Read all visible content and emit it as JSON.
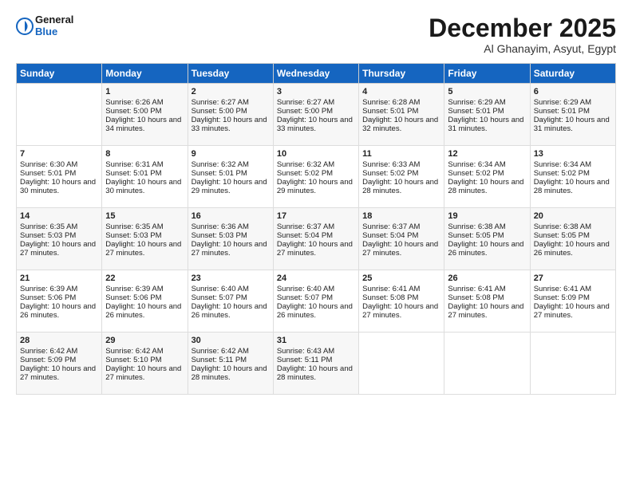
{
  "header": {
    "logo_line1": "General",
    "logo_line2": "Blue",
    "month": "December 2025",
    "location": "Al Ghanayim, Asyut, Egypt"
  },
  "days_of_week": [
    "Sunday",
    "Monday",
    "Tuesday",
    "Wednesday",
    "Thursday",
    "Friday",
    "Saturday"
  ],
  "weeks": [
    [
      {
        "day": "",
        "sunrise": "",
        "sunset": "",
        "daylight": ""
      },
      {
        "day": "1",
        "sunrise": "Sunrise: 6:26 AM",
        "sunset": "Sunset: 5:00 PM",
        "daylight": "Daylight: 10 hours and 34 minutes."
      },
      {
        "day": "2",
        "sunrise": "Sunrise: 6:27 AM",
        "sunset": "Sunset: 5:00 PM",
        "daylight": "Daylight: 10 hours and 33 minutes."
      },
      {
        "day": "3",
        "sunrise": "Sunrise: 6:27 AM",
        "sunset": "Sunset: 5:00 PM",
        "daylight": "Daylight: 10 hours and 33 minutes."
      },
      {
        "day": "4",
        "sunrise": "Sunrise: 6:28 AM",
        "sunset": "Sunset: 5:01 PM",
        "daylight": "Daylight: 10 hours and 32 minutes."
      },
      {
        "day": "5",
        "sunrise": "Sunrise: 6:29 AM",
        "sunset": "Sunset: 5:01 PM",
        "daylight": "Daylight: 10 hours and 31 minutes."
      },
      {
        "day": "6",
        "sunrise": "Sunrise: 6:29 AM",
        "sunset": "Sunset: 5:01 PM",
        "daylight": "Daylight: 10 hours and 31 minutes."
      }
    ],
    [
      {
        "day": "7",
        "sunrise": "Sunrise: 6:30 AM",
        "sunset": "Sunset: 5:01 PM",
        "daylight": "Daylight: 10 hours and 30 minutes."
      },
      {
        "day": "8",
        "sunrise": "Sunrise: 6:31 AM",
        "sunset": "Sunset: 5:01 PM",
        "daylight": "Daylight: 10 hours and 30 minutes."
      },
      {
        "day": "9",
        "sunrise": "Sunrise: 6:32 AM",
        "sunset": "Sunset: 5:01 PM",
        "daylight": "Daylight: 10 hours and 29 minutes."
      },
      {
        "day": "10",
        "sunrise": "Sunrise: 6:32 AM",
        "sunset": "Sunset: 5:02 PM",
        "daylight": "Daylight: 10 hours and 29 minutes."
      },
      {
        "day": "11",
        "sunrise": "Sunrise: 6:33 AM",
        "sunset": "Sunset: 5:02 PM",
        "daylight": "Daylight: 10 hours and 28 minutes."
      },
      {
        "day": "12",
        "sunrise": "Sunrise: 6:34 AM",
        "sunset": "Sunset: 5:02 PM",
        "daylight": "Daylight: 10 hours and 28 minutes."
      },
      {
        "day": "13",
        "sunrise": "Sunrise: 6:34 AM",
        "sunset": "Sunset: 5:02 PM",
        "daylight": "Daylight: 10 hours and 28 minutes."
      }
    ],
    [
      {
        "day": "14",
        "sunrise": "Sunrise: 6:35 AM",
        "sunset": "Sunset: 5:03 PM",
        "daylight": "Daylight: 10 hours and 27 minutes."
      },
      {
        "day": "15",
        "sunrise": "Sunrise: 6:35 AM",
        "sunset": "Sunset: 5:03 PM",
        "daylight": "Daylight: 10 hours and 27 minutes."
      },
      {
        "day": "16",
        "sunrise": "Sunrise: 6:36 AM",
        "sunset": "Sunset: 5:03 PM",
        "daylight": "Daylight: 10 hours and 27 minutes."
      },
      {
        "day": "17",
        "sunrise": "Sunrise: 6:37 AM",
        "sunset": "Sunset: 5:04 PM",
        "daylight": "Daylight: 10 hours and 27 minutes."
      },
      {
        "day": "18",
        "sunrise": "Sunrise: 6:37 AM",
        "sunset": "Sunset: 5:04 PM",
        "daylight": "Daylight: 10 hours and 27 minutes."
      },
      {
        "day": "19",
        "sunrise": "Sunrise: 6:38 AM",
        "sunset": "Sunset: 5:05 PM",
        "daylight": "Daylight: 10 hours and 26 minutes."
      },
      {
        "day": "20",
        "sunrise": "Sunrise: 6:38 AM",
        "sunset": "Sunset: 5:05 PM",
        "daylight": "Daylight: 10 hours and 26 minutes."
      }
    ],
    [
      {
        "day": "21",
        "sunrise": "Sunrise: 6:39 AM",
        "sunset": "Sunset: 5:06 PM",
        "daylight": "Daylight: 10 hours and 26 minutes."
      },
      {
        "day": "22",
        "sunrise": "Sunrise: 6:39 AM",
        "sunset": "Sunset: 5:06 PM",
        "daylight": "Daylight: 10 hours and 26 minutes."
      },
      {
        "day": "23",
        "sunrise": "Sunrise: 6:40 AM",
        "sunset": "Sunset: 5:07 PM",
        "daylight": "Daylight: 10 hours and 26 minutes."
      },
      {
        "day": "24",
        "sunrise": "Sunrise: 6:40 AM",
        "sunset": "Sunset: 5:07 PM",
        "daylight": "Daylight: 10 hours and 26 minutes."
      },
      {
        "day": "25",
        "sunrise": "Sunrise: 6:41 AM",
        "sunset": "Sunset: 5:08 PM",
        "daylight": "Daylight: 10 hours and 27 minutes."
      },
      {
        "day": "26",
        "sunrise": "Sunrise: 6:41 AM",
        "sunset": "Sunset: 5:08 PM",
        "daylight": "Daylight: 10 hours and 27 minutes."
      },
      {
        "day": "27",
        "sunrise": "Sunrise: 6:41 AM",
        "sunset": "Sunset: 5:09 PM",
        "daylight": "Daylight: 10 hours and 27 minutes."
      }
    ],
    [
      {
        "day": "28",
        "sunrise": "Sunrise: 6:42 AM",
        "sunset": "Sunset: 5:09 PM",
        "daylight": "Daylight: 10 hours and 27 minutes."
      },
      {
        "day": "29",
        "sunrise": "Sunrise: 6:42 AM",
        "sunset": "Sunset: 5:10 PM",
        "daylight": "Daylight: 10 hours and 27 minutes."
      },
      {
        "day": "30",
        "sunrise": "Sunrise: 6:42 AM",
        "sunset": "Sunset: 5:11 PM",
        "daylight": "Daylight: 10 hours and 28 minutes."
      },
      {
        "day": "31",
        "sunrise": "Sunrise: 6:43 AM",
        "sunset": "Sunset: 5:11 PM",
        "daylight": "Daylight: 10 hours and 28 minutes."
      },
      {
        "day": "",
        "sunrise": "",
        "sunset": "",
        "daylight": ""
      },
      {
        "day": "",
        "sunrise": "",
        "sunset": "",
        "daylight": ""
      },
      {
        "day": "",
        "sunrise": "",
        "sunset": "",
        "daylight": ""
      }
    ]
  ]
}
